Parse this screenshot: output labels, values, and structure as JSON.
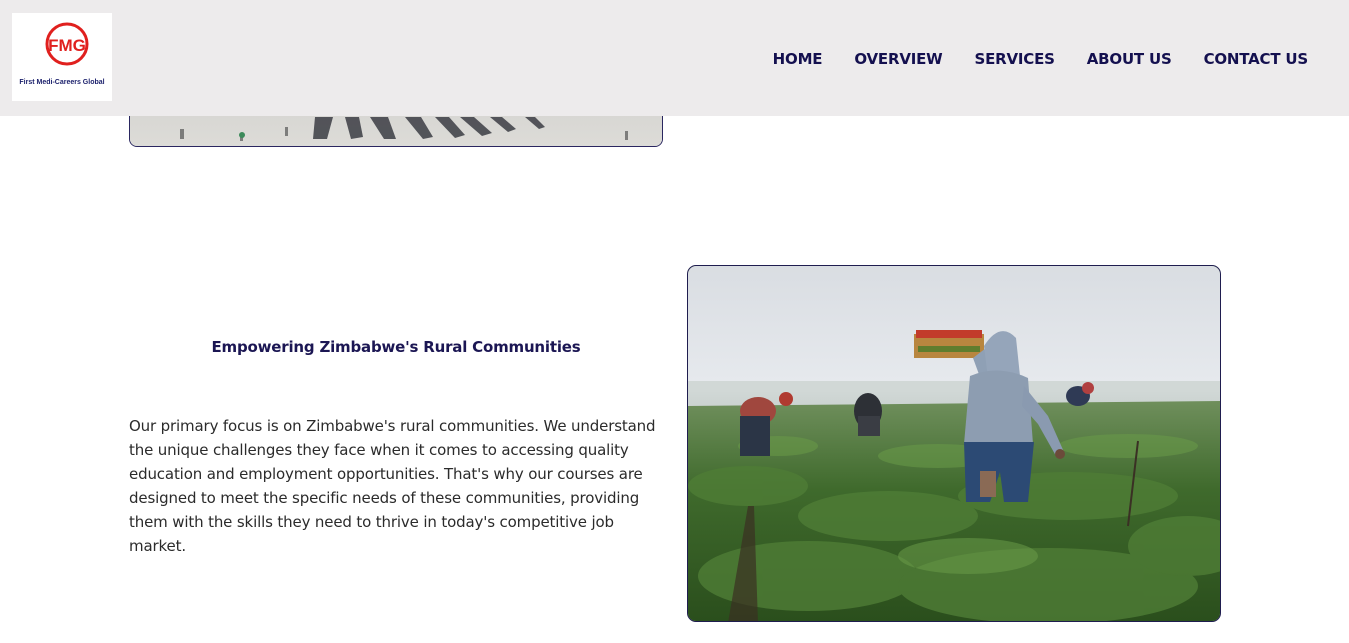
{
  "logo": {
    "initials": "FMG",
    "caption": "First Medi-Careers Global"
  },
  "nav": {
    "items": [
      "HOME",
      "OVERVIEW",
      "SERVICES",
      "ABOUT US",
      "CONTACT US"
    ]
  },
  "section": {
    "title": "Empowering Zimbabwe's Rural Communities",
    "body": "Our primary focus is on Zimbabwe's rural communities. We understand the unique challenges they face when it comes to accessing quality education and employment opportunities. That's why our courses are designed to meet the specific needs of these communities, providing them with the skills they need to thrive in today's competitive job market."
  },
  "colors": {
    "header_bg": "#edebec",
    "nav_text": "#14104f",
    "title_text": "#1b1653",
    "body_text": "#2b2b2b",
    "logo_red": "#e0201e",
    "logo_blue": "#1a2f8a"
  }
}
